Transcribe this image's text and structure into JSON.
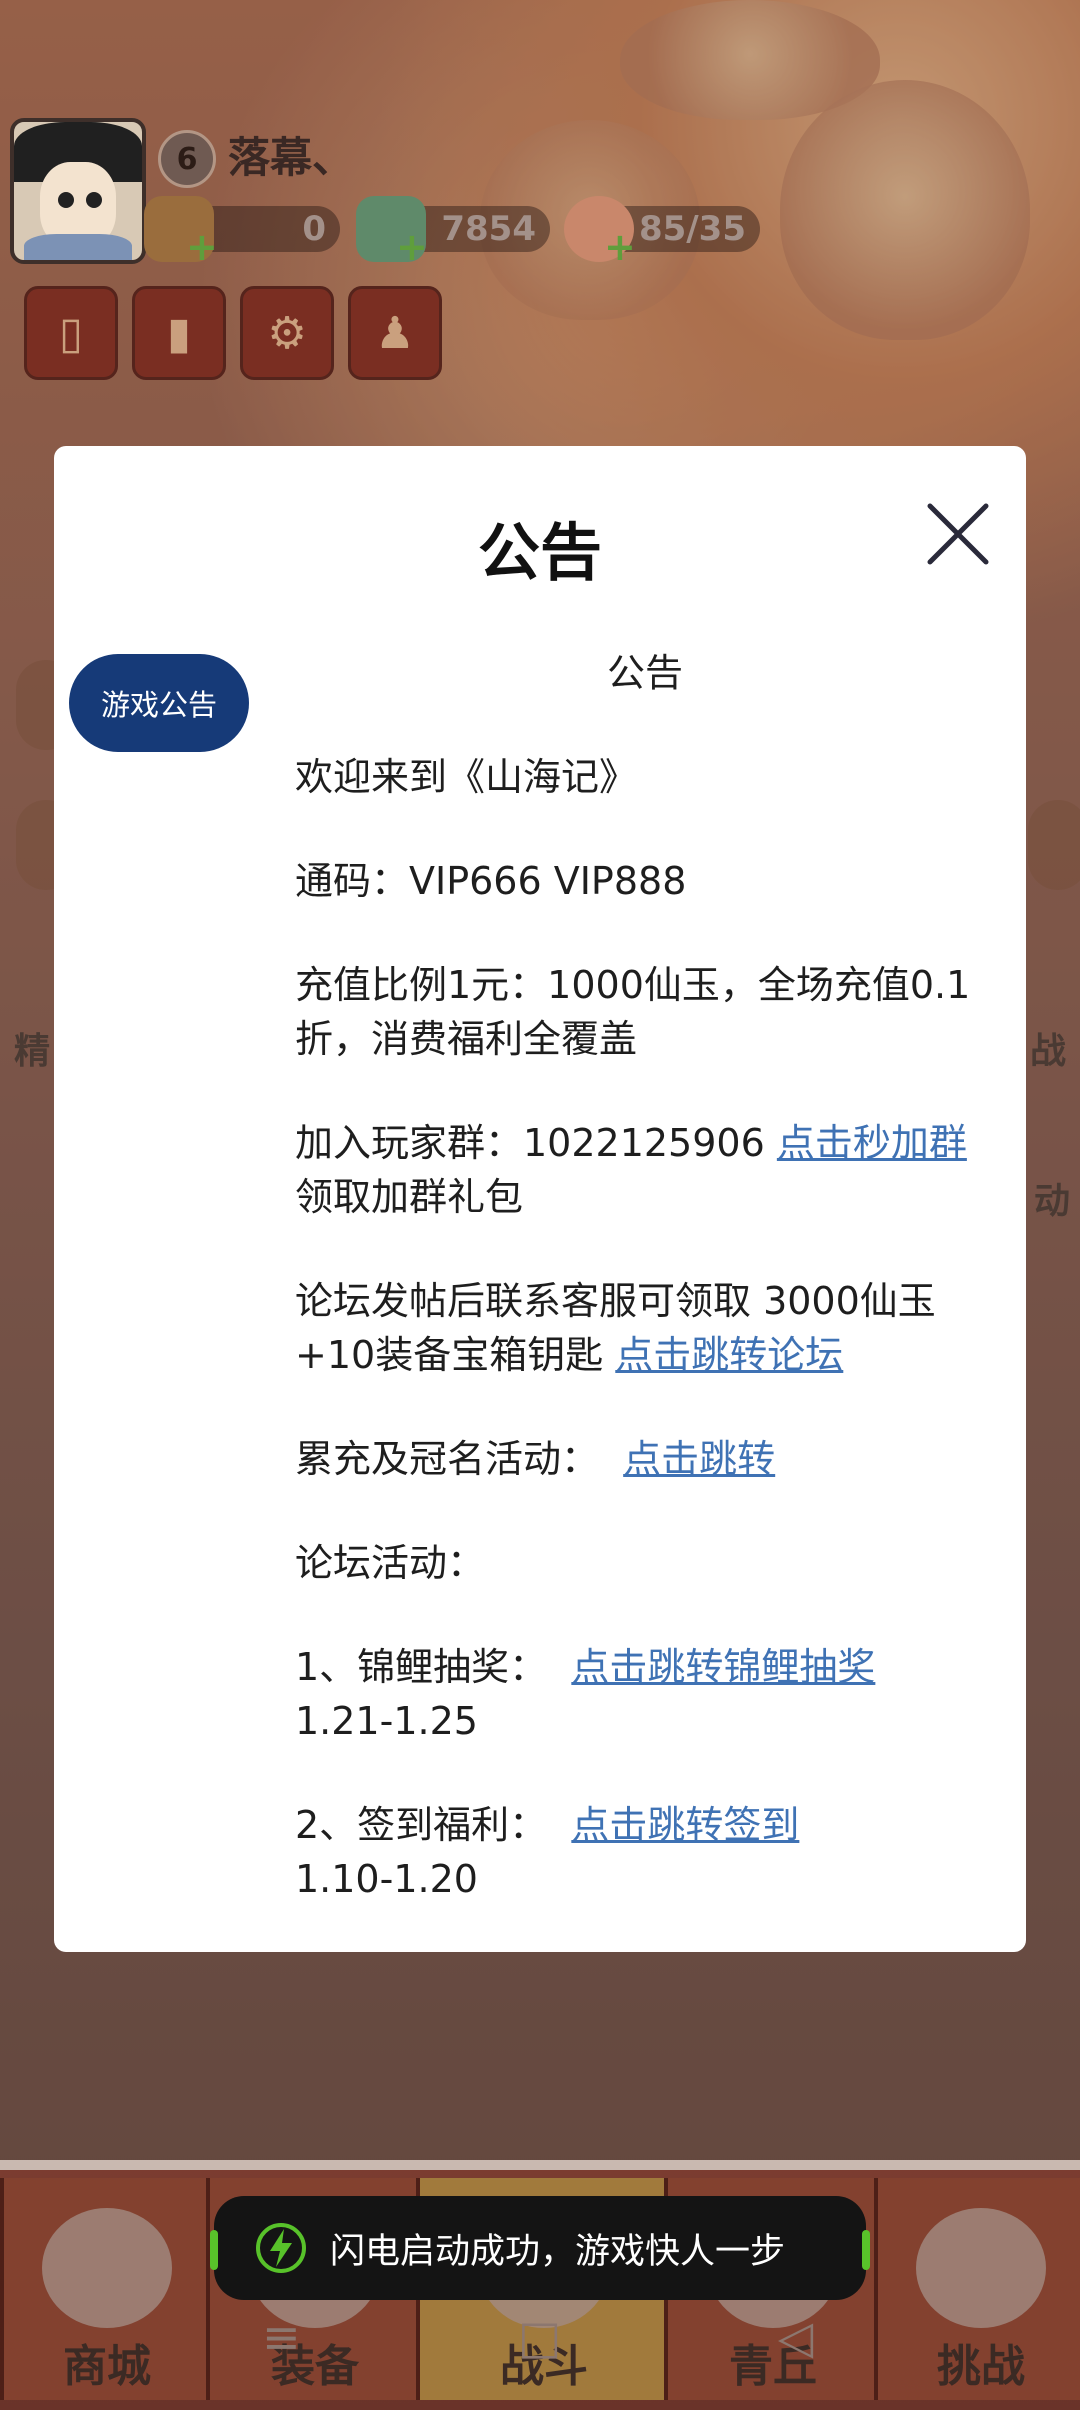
{
  "player": {
    "name": "落幕、",
    "level": "6"
  },
  "resources": [
    {
      "icon": "gift-box-icon",
      "value": "0"
    },
    {
      "icon": "jade-dragon-icon",
      "value": "7854"
    },
    {
      "icon": "peach-stamina-icon",
      "value": "85/35"
    }
  ],
  "top_buttons": [
    "card-icon",
    "ranking-icon",
    "settings-gear-icon",
    "friends-icon"
  ],
  "side_labels": {
    "left": "精",
    "right_1": "战",
    "right_2": "动"
  },
  "bottom_nav": {
    "tabs": [
      "商城",
      "装备",
      "战斗",
      "青丘",
      "挑战"
    ]
  },
  "dialog": {
    "title": "公告",
    "tab_label": "游戏公告",
    "content": {
      "heading": "公告",
      "welcome": "欢迎来到《山海记》",
      "codes": "通码：VIP666 VIP888",
      "recharge": "充值比例1元：1000仙玉，全场充值0.1折，消费福利全覆盖",
      "group_prefix": "加入玩家群：1022125906 ",
      "group_link": "点击秒加群",
      "group_suffix": " 领取加群礼包",
      "forum_prefix": "论坛发帖后联系客服可领取 3000仙玉+10装备宝箱钥匙 ",
      "forum_link": "点击跳转论坛",
      "cumulative_prefix": "累充及冠名活动：  ",
      "cumulative_link": "点击跳转",
      "forum_events": "论坛活动：",
      "event1_prefix": "1、锦鲤抽奖：  ",
      "event1_link": "点击跳转锦鲤抽奖",
      "event1_dates": "1.21-1.25",
      "event2_prefix": "2、签到福利：  ",
      "event2_link": "点击跳转签到",
      "event2_dates": "1.10-1.20"
    }
  },
  "toast": {
    "text": "闪电启动成功，游戏快人一步",
    "accent_color": "#58c22a"
  },
  "colors": {
    "dialog_tab": "#163a78",
    "link": "#3f72b4"
  }
}
